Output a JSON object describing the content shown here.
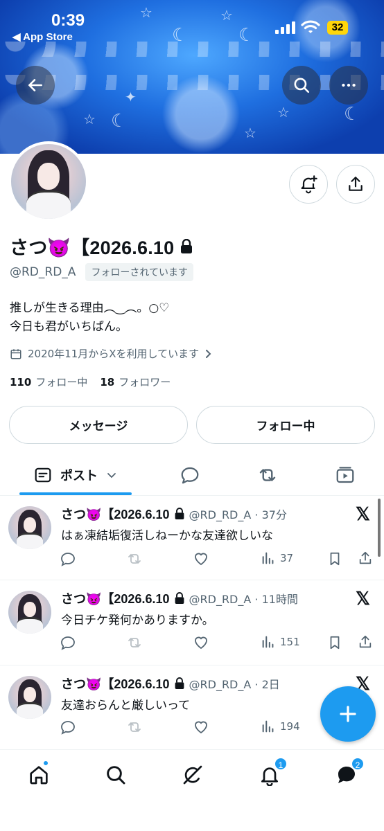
{
  "status": {
    "time": "0:39",
    "back_app": "◀ App Store",
    "battery": "32"
  },
  "profile": {
    "display_name": "さつ😈【2026.6.10",
    "handle": "@RD_RD_A",
    "follows_you": "フォローされています",
    "bio_line1": "推しが生きる理由︵‿︵。○♡",
    "bio_line2": "今日も君がいちばん。",
    "joined": "2020年11月からXを利用しています",
    "following_count": "110",
    "following_label": "フォロー中",
    "followers_count": "18",
    "followers_label": "フォロワー"
  },
  "buttons": {
    "message": "メッセージ",
    "following": "フォロー中"
  },
  "tabs": {
    "posts": "ポスト"
  },
  "posts": [
    {
      "name": "さつ😈【2026.6.10",
      "meta": "@RD_RD_A · 37分",
      "text": "はぁ凍結垢復活しねーかな友達欲しいな",
      "views": "37"
    },
    {
      "name": "さつ😈【2026.6.10",
      "meta": "@RD_RD_A · 11時間",
      "text": "今日チケ発何かありますか。",
      "views": "151"
    },
    {
      "name": "さつ😈【2026.6.10",
      "meta": "@RD_RD_A · 2日",
      "text": "友達おらんと厳しいって",
      "views": "194"
    }
  ],
  "nav": {
    "notifications_badge": "1",
    "messages_badge": "2"
  },
  "colors": {
    "accent": "#1d9bf0",
    "text": "#0f1419",
    "muted": "#536471"
  }
}
